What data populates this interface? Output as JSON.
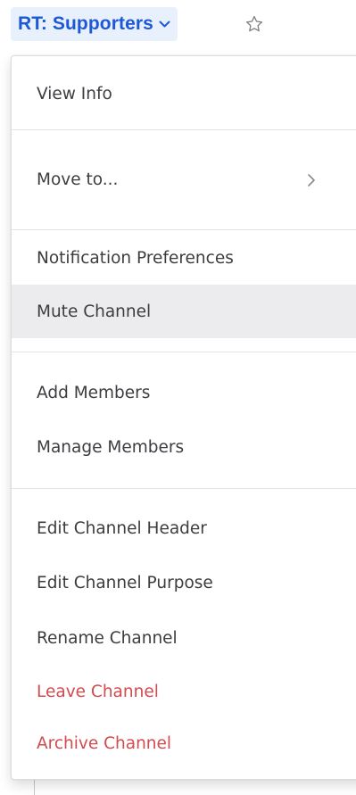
{
  "header": {
    "channel_name": "RT: Supporters"
  },
  "menu": {
    "view_info": "View Info",
    "move_to": "Move to...",
    "notification_preferences": "Notification Preferences",
    "mute_channel": "Mute Channel",
    "add_members": "Add Members",
    "manage_members": "Manage Members",
    "edit_channel_header": "Edit Channel Header",
    "edit_channel_purpose": "Edit Channel Purpose",
    "rename_channel": "Rename Channel",
    "leave_channel": "Leave Channel",
    "archive_channel": "Archive Channel"
  },
  "icons": {
    "dropdown": "chevron-down-icon",
    "favorite": "star-outline-icon",
    "submenu": "chevron-right-icon"
  },
  "colors": {
    "channel_name": "#1c58d9",
    "channel_button_bg": "#e8f0fb",
    "danger": "#d24b4e",
    "hover_bg": "#ececee",
    "text": "#3d3c40"
  }
}
